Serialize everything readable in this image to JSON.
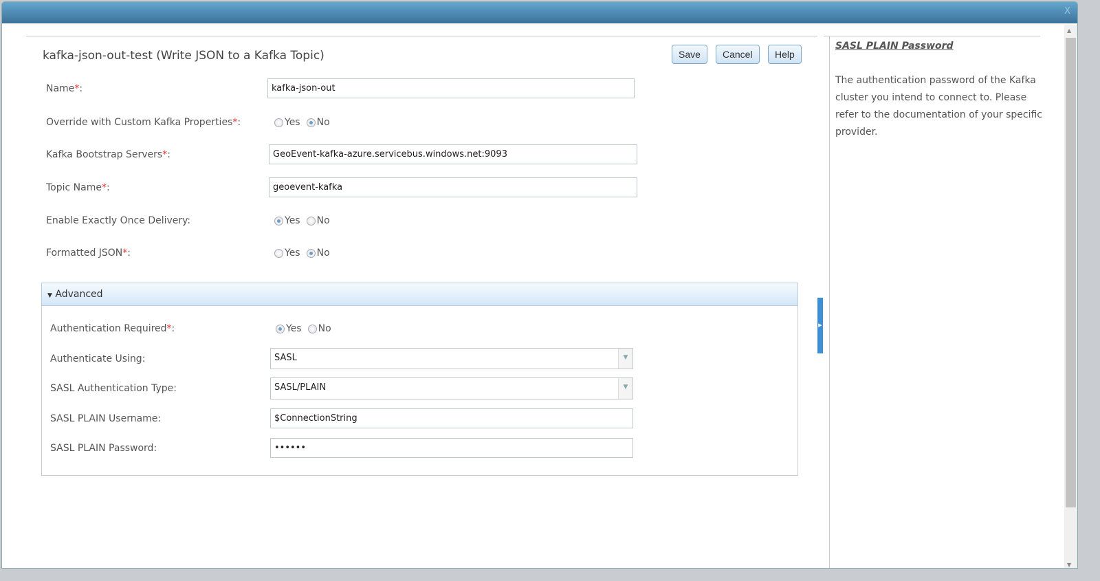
{
  "window": {
    "close_label": "X"
  },
  "header": {
    "title": "kafka-json-out-test (Write JSON to a Kafka Topic)",
    "save": "Save",
    "cancel": "Cancel",
    "help": "Help"
  },
  "required_mark": "*",
  "fields": {
    "name": {
      "label": "Name",
      "value": "kafka-json-out"
    },
    "override": {
      "label": "Override with Custom Kafka Properties",
      "yes": "Yes",
      "no": "No",
      "selected": "No"
    },
    "bootstrap": {
      "label": "Kafka Bootstrap Servers",
      "value": "GeoEvent-kafka-azure.servicebus.windows.net:9093"
    },
    "topic": {
      "label": "Topic Name",
      "value": "geoevent-kafka"
    },
    "exactly_once": {
      "label": "Enable Exactly Once Delivery:",
      "yes": "Yes",
      "no": "No",
      "selected": "Yes"
    },
    "formatted": {
      "label": "Formatted JSON",
      "yes": "Yes",
      "no": "No",
      "selected": "No"
    }
  },
  "advanced": {
    "label": "Advanced",
    "auth_required": {
      "label": "Authentication Required",
      "yes": "Yes",
      "no": "No",
      "selected": "Yes"
    },
    "auth_using": {
      "label": "Authenticate Using:",
      "value": "SASL"
    },
    "sasl_type": {
      "label": "SASL Authentication Type:",
      "value": "SASL/PLAIN"
    },
    "username": {
      "label": "SASL PLAIN Username:",
      "value": "$ConnectionString"
    },
    "password": {
      "label": "SASL PLAIN Password:",
      "value": "••••••"
    }
  },
  "help_panel": {
    "title": "SASL PLAIN Password",
    "text": "The authentication password of the Kafka cluster you intend to connect to. Please refer to the documentation of your specific provider."
  }
}
